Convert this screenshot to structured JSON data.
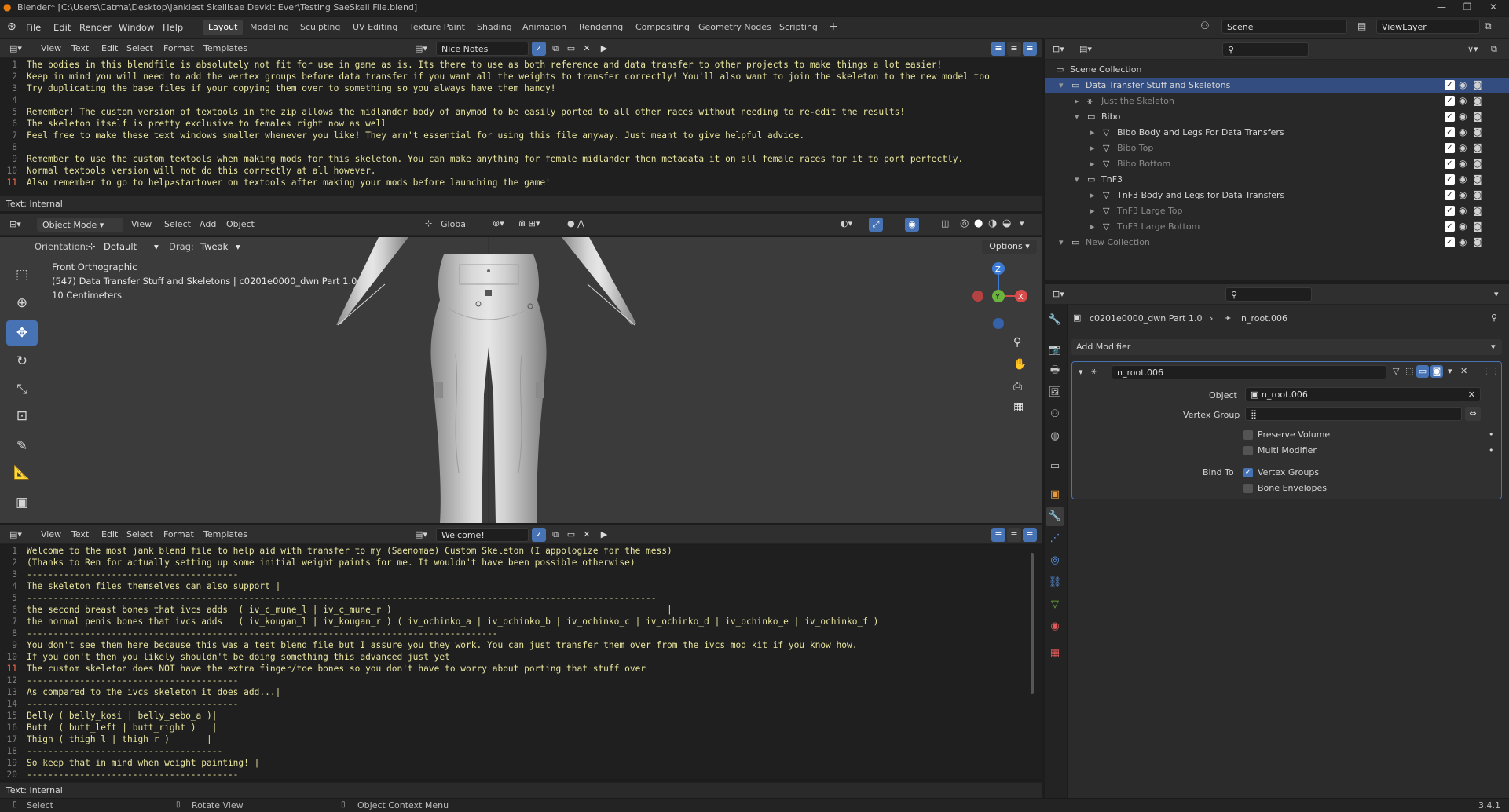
{
  "window": {
    "title": "Blender* [C:\\Users\\Catma\\Desktop\\Jankiest Skellisae Devkit Ever\\Testing SaeSkell File.blend]"
  },
  "menu": [
    "File",
    "Edit",
    "Render",
    "Window",
    "Help"
  ],
  "workspaces": [
    "Layout",
    "Modeling",
    "Sculpting",
    "UV Editing",
    "Texture Paint",
    "Shading",
    "Animation",
    "Rendering",
    "Compositing",
    "Geometry Nodes",
    "Scripting"
  ],
  "active_workspace": "Layout",
  "scene": {
    "scene_name": "Scene",
    "view_layer": "ViewLayer"
  },
  "text_editor_top": {
    "menu": [
      "View",
      "Text",
      "Edit",
      "Select",
      "Format",
      "Templates"
    ],
    "text_name": "Nice Notes",
    "status": "Text: Internal",
    "lines": [
      {
        "n": "1",
        "t": "The bodies in this blendfile is absolutely not fit for use in game as is. Its there to use as both reference and data transfer to other projects to make things a lot easier!"
      },
      {
        "n": "2",
        "t": "Keep in mind you will need to add the vertex groups before data transfer if you want all the weights to transfer correctly! You'll also want to join the skeleton to the new model too"
      },
      {
        "n": "3",
        "t": "Try duplicating the base files if your copying them over to something so you always have them handy!"
      },
      {
        "n": "4",
        "t": ""
      },
      {
        "n": "5",
        "t": "Remember! The custom version of textools in the zip allows the midlander body of anymod to be easily ported to all other races without needing to re-edit the results!"
      },
      {
        "n": "6",
        "t": "The skeleton itself is pretty exclusive to females right now as well"
      },
      {
        "n": "7",
        "t": "Feel free to make these text windows smaller whenever you like! They arn't essential for using this file anyway. Just meant to give helpful advice."
      },
      {
        "n": "8",
        "t": ""
      },
      {
        "n": "9",
        "t": "Remember to use the custom textools when making mods for this skeleton. You can make anything for female midlander then metadata it on all female races for it to port perfectly."
      },
      {
        "n": "10",
        "t": "Normal textools version will not do this correctly at all however."
      },
      {
        "n": "11",
        "t": "Also remember to go to help>startover on textools after making your mods before launching the game!"
      }
    ]
  },
  "viewport": {
    "mode": "Object Mode",
    "menu": [
      "View",
      "Select",
      "Add",
      "Object"
    ],
    "transform": "Global",
    "orientation_label": "Orientation:",
    "orientation_value": "Default",
    "drag_label": "Drag:",
    "drag_value": "Tweak",
    "options": "Options",
    "overlay_title": "Front Orthographic",
    "overlay_object": "(547) Data Transfer Stuff and Skeletons | c0201e0000_dwn Part 1.0",
    "overlay_scale": "10 Centimeters"
  },
  "text_editor_bottom": {
    "menu": [
      "View",
      "Text",
      "Edit",
      "Select",
      "Format",
      "Templates"
    ],
    "text_name": "Welcome!",
    "status": "Text: Internal",
    "lines": [
      {
        "n": "1",
        "t": "Welcome to the most jank blend file to help aid with transfer to my (Saenomae) Custom Skeleton (I appologize for the mess)"
      },
      {
        "n": "2",
        "t": "(Thanks to Ren for actually setting up some initial weight paints for me. It wouldn't have been possible otherwise)"
      },
      {
        "n": "3",
        "t": "----------------------------------------"
      },
      {
        "n": "4",
        "t": "The skeleton files themselves can also support |"
      },
      {
        "n": "5",
        "t": "-----------------------------------------------------------------------------------------------------------------------"
      },
      {
        "n": "6",
        "t": "the second breast bones that ivcs adds  ( iv_c_mune_l | iv_c_mune_r )                                                    |"
      },
      {
        "n": "7",
        "t": "the normal penis bones that ivcs adds   ( iv_kougan_l | iv_kougan_r ) ( iv_ochinko_a | iv_ochinko_b | iv_ochinko_c | iv_ochinko_d | iv_ochinko_e | iv_ochinko_f )"
      },
      {
        "n": "8",
        "t": "-----------------------------------------------------------------------------------------"
      },
      {
        "n": "9",
        "t": "You don't see them here because this was a test blend file but I assure you they work. You can just transfer them over from the ivcs mod kit if you know how."
      },
      {
        "n": "10",
        "t": "If you don't then you likely shouldn't be doing something this advanced just yet"
      },
      {
        "n": "11",
        "t": "The custom skeleton does NOT have the extra finger/toe bones so you don't have to worry about porting that stuff over"
      },
      {
        "n": "12",
        "t": "----------------------------------------"
      },
      {
        "n": "13",
        "t": "As compared to the ivcs skeleton it does add...|"
      },
      {
        "n": "14",
        "t": "----------------------------------------"
      },
      {
        "n": "15",
        "t": "Belly ( belly_kosi | belly_sebo_a )|"
      },
      {
        "n": "16",
        "t": "Butt  ( butt_left | butt_right )   |"
      },
      {
        "n": "17",
        "t": "Thigh ( thigh_l | thigh_r )       |"
      },
      {
        "n": "18",
        "t": "-------------------------------------"
      },
      {
        "n": "19",
        "t": "So keep that in mind when weight painting! |"
      },
      {
        "n": "20",
        "t": "----------------------------------------"
      }
    ]
  },
  "outliner": {
    "rows": [
      {
        "label": "Scene Collection",
        "depth": 0,
        "dim": false,
        "sel": false,
        "checks": false
      },
      {
        "label": "Data Transfer Stuff and Skeletons",
        "depth": 1,
        "dim": false,
        "sel": true,
        "checks": true
      },
      {
        "label": "Just the Skeleton",
        "depth": 2,
        "dim": true,
        "sel": false,
        "checks": true
      },
      {
        "label": "Bibo",
        "depth": 2,
        "dim": false,
        "sel": false,
        "checks": true
      },
      {
        "label": "Bibo Body and Legs For Data Transfers",
        "depth": 3,
        "dim": false,
        "sel": false,
        "checks": true
      },
      {
        "label": "Bibo Top",
        "depth": 3,
        "dim": true,
        "sel": false,
        "checks": true
      },
      {
        "label": "Bibo Bottom",
        "depth": 3,
        "dim": true,
        "sel": false,
        "checks": true
      },
      {
        "label": "TnF3",
        "depth": 2,
        "dim": false,
        "sel": false,
        "checks": true
      },
      {
        "label": "TnF3 Body and Legs for Data Transfers",
        "depth": 3,
        "dim": false,
        "sel": false,
        "checks": true
      },
      {
        "label": "TnF3 Large Top",
        "depth": 3,
        "dim": true,
        "sel": false,
        "checks": true
      },
      {
        "label": "TnF3 Large Bottom",
        "depth": 3,
        "dim": true,
        "sel": false,
        "checks": true
      },
      {
        "label": "New Collection",
        "depth": 1,
        "dim": true,
        "sel": false,
        "checks": true
      }
    ]
  },
  "properties": {
    "breadcrumb_object": "c0201e0000_dwn Part 1.0",
    "breadcrumb_modifier": "n_root.006",
    "add_modifier": "Add Modifier",
    "modifier_name": "n_root.006",
    "object_label": "Object",
    "object_value": "n_root.006",
    "vertex_group_label": "Vertex Group",
    "preserve_volume": "Preserve Volume",
    "multi_modifier": "Multi Modifier",
    "bind_to_label": "Bind To",
    "vertex_groups": "Vertex Groups",
    "bone_envelopes": "Bone Envelopes"
  },
  "statusbar": {
    "select": "Select",
    "rotate": "Rotate View",
    "context": "Object Context Menu",
    "version": "3.4.1"
  },
  "colors": {
    "accent": "#4772b3",
    "selected_row": "#334d80",
    "text_yellow": "#e8e59e",
    "keyword_red": "#e05a5a"
  }
}
